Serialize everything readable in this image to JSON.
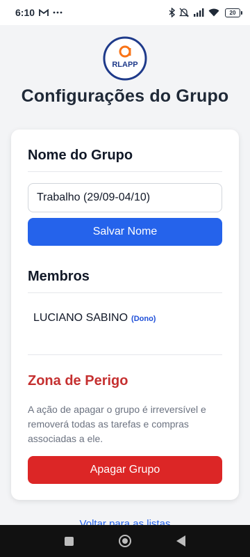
{
  "status_bar": {
    "time": "6:10",
    "battery": "20"
  },
  "logo": {
    "text": "RLAPP"
  },
  "page": {
    "title": "Configurações do Grupo"
  },
  "group_name": {
    "heading": "Nome do Grupo",
    "value": "Trabalho (29/09-04/10)",
    "save_label": "Salvar Nome"
  },
  "members": {
    "heading": "Membros",
    "items": [
      {
        "name": "LUCIANO SABINO",
        "role": "(Dono)"
      }
    ]
  },
  "danger_zone": {
    "heading": "Zona de Perigo",
    "text": "A ação de apagar o grupo é irreversível e removerá todas as tarefas e compras associadas a ele.",
    "delete_label": "Apagar Grupo"
  },
  "footer": {
    "back_link": "Voltar para as listas"
  },
  "colors": {
    "primary": "#2563eb",
    "danger": "#dc2626",
    "danger_text": "#c53030",
    "background": "#f3f4f6"
  }
}
